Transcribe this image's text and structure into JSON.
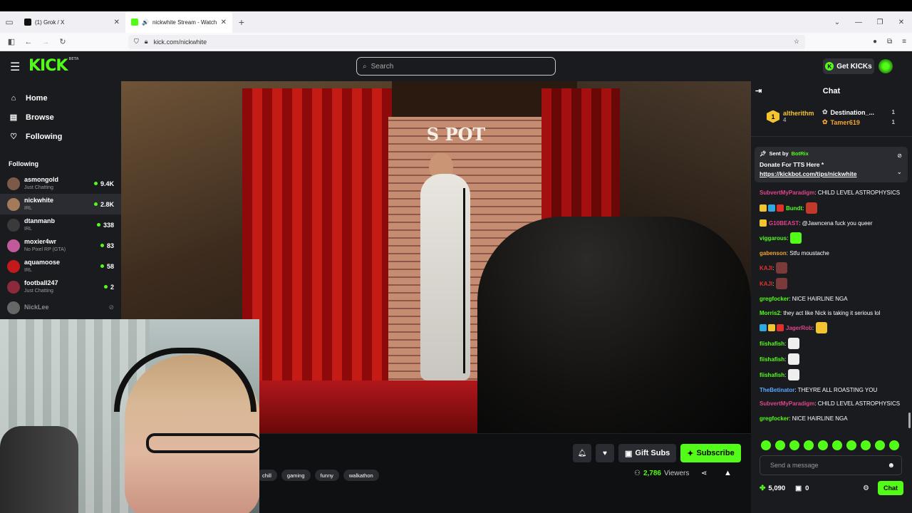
{
  "browser": {
    "tabs": [
      {
        "title": "(1) Grok / X",
        "icon": "x-logo-icon"
      },
      {
        "title": "nickwhite Stream - Watch Live on Kick",
        "icon": "kick-logo-icon"
      }
    ],
    "url": "kick.com/nickwhite"
  },
  "kick": {
    "logo": "KICK",
    "logo_beta": "BETA",
    "search_placeholder": "Search",
    "get_kicks_label": "Get KICKs"
  },
  "sidebar": {
    "nav": [
      {
        "label": "Home",
        "icon": "home-icon"
      },
      {
        "label": "Browse",
        "icon": "browse-icon"
      },
      {
        "label": "Following",
        "icon": "heart-icon"
      }
    ],
    "following_header": "Following",
    "following": [
      {
        "name": "asmongold",
        "category": "Just Chatting",
        "viewers": "9.4K",
        "color": "#7c5a4a"
      },
      {
        "name": "nickwhite",
        "category": "IRL",
        "viewers": "2.8K",
        "color": "#a37a5a"
      },
      {
        "name": "dtanmanb",
        "category": "IRL",
        "viewers": "338",
        "color": "#3a3a3a"
      },
      {
        "name": "moxier4wr",
        "category": "No Pixel RP (GTA)",
        "viewers": "83",
        "color": "#c15a9a"
      },
      {
        "name": "aquamoose",
        "category": "IRL",
        "viewers": "58",
        "color": "#c21a1a"
      },
      {
        "name": "football247",
        "category": "Just Chatting",
        "viewers": "2",
        "color": "#8a2a3a"
      },
      {
        "name": "NickLee",
        "category": "",
        "viewers": "",
        "color": "#666"
      }
    ]
  },
  "stream": {
    "tags": [
      "chill",
      "gaming",
      "funny",
      "walkathon"
    ],
    "gift_label": "Gift Subs",
    "subscribe_label": "Subscribe",
    "viewers_count": "2,786",
    "viewers_label": "Viewers",
    "sign_text": "S POT"
  },
  "chat": {
    "title": "Chat",
    "top_gifter": {
      "rank": "1",
      "name": "altherithm",
      "count": "4"
    },
    "gifters": [
      {
        "name": "Destination_...",
        "count": "1"
      },
      {
        "name": "Tamer619",
        "count": "1"
      }
    ],
    "pinned": {
      "sent_by": "Sent by",
      "bot_name": "BotRix",
      "text": "Donate For TTS Here *",
      "link": "https://kickbot.com/tips/nickwhite"
    },
    "messages": [
      {
        "user": "SubvertMyParadigm",
        "color": "#e0458a",
        "text": ": CHILD LEVEL ASTROPHYSICS",
        "multi": true
      },
      {
        "user": "Bundt",
        "color": "#53fc18",
        "text": ":",
        "emote": "#c0392b",
        "badges": [
          "#f3c431",
          "#2fa8e0",
          "#e0322a"
        ]
      },
      {
        "user": "G10BEAST",
        "color": "#e0458a",
        "text": ": @Jawncena fuck you queer",
        "badges": [
          "#f3c431"
        ]
      },
      {
        "user": "viggarous",
        "color": "#53fc18",
        "text": ":",
        "emote": "#53fc18"
      },
      {
        "user": "gabenson",
        "color": "#f3a431",
        "text": ": Stfu moustache"
      },
      {
        "user": "KAJI",
        "color": "#e0322a",
        "text": ":",
        "emote": "#7a3a3a"
      },
      {
        "user": "KAJI",
        "color": "#e0322a",
        "text": ":",
        "emote": "#7a3a3a"
      },
      {
        "user": "gregfocker",
        "color": "#53fc18",
        "text": ": NICE HAIRLINE NGA"
      },
      {
        "user": "Morris2",
        "color": "#53fc18",
        "text": ": they act like Nick is taking it serious lol"
      },
      {
        "user": "JagerRob",
        "color": "#e0458a",
        "text": ":",
        "emote": "#f3c431",
        "badges": [
          "#2fa8e0",
          "#f3c431",
          "#e0322a"
        ]
      },
      {
        "user": "fiishafish",
        "color": "#53fc18",
        "text": ":",
        "emote": "#eeeeee"
      },
      {
        "user": "fiishafish",
        "color": "#53fc18",
        "text": ":",
        "emote": "#eeeeee"
      },
      {
        "user": "fiishafish",
        "color": "#53fc18",
        "text": ":",
        "emote": "#eeeeee"
      },
      {
        "user": "TheBetinator",
        "color": "#5aa8ff",
        "text": ": THEYRE ALL ROASTING YOU"
      },
      {
        "user": "SubvertMyParadigm",
        "color": "#e0458a",
        "text": ": CHILD LEVEL ASTROPHYSICS",
        "multi": true
      },
      {
        "user": "gregfocker",
        "color": "#53fc18",
        "text": ": NICE HAIRLINE NGA"
      }
    ],
    "input_placeholder": "Send a message",
    "kicks_balance": "5,090",
    "gift_count": "0",
    "chat_button": "Chat"
  },
  "colors": {
    "accent": "#53fc18",
    "bg": "#191b1f"
  }
}
